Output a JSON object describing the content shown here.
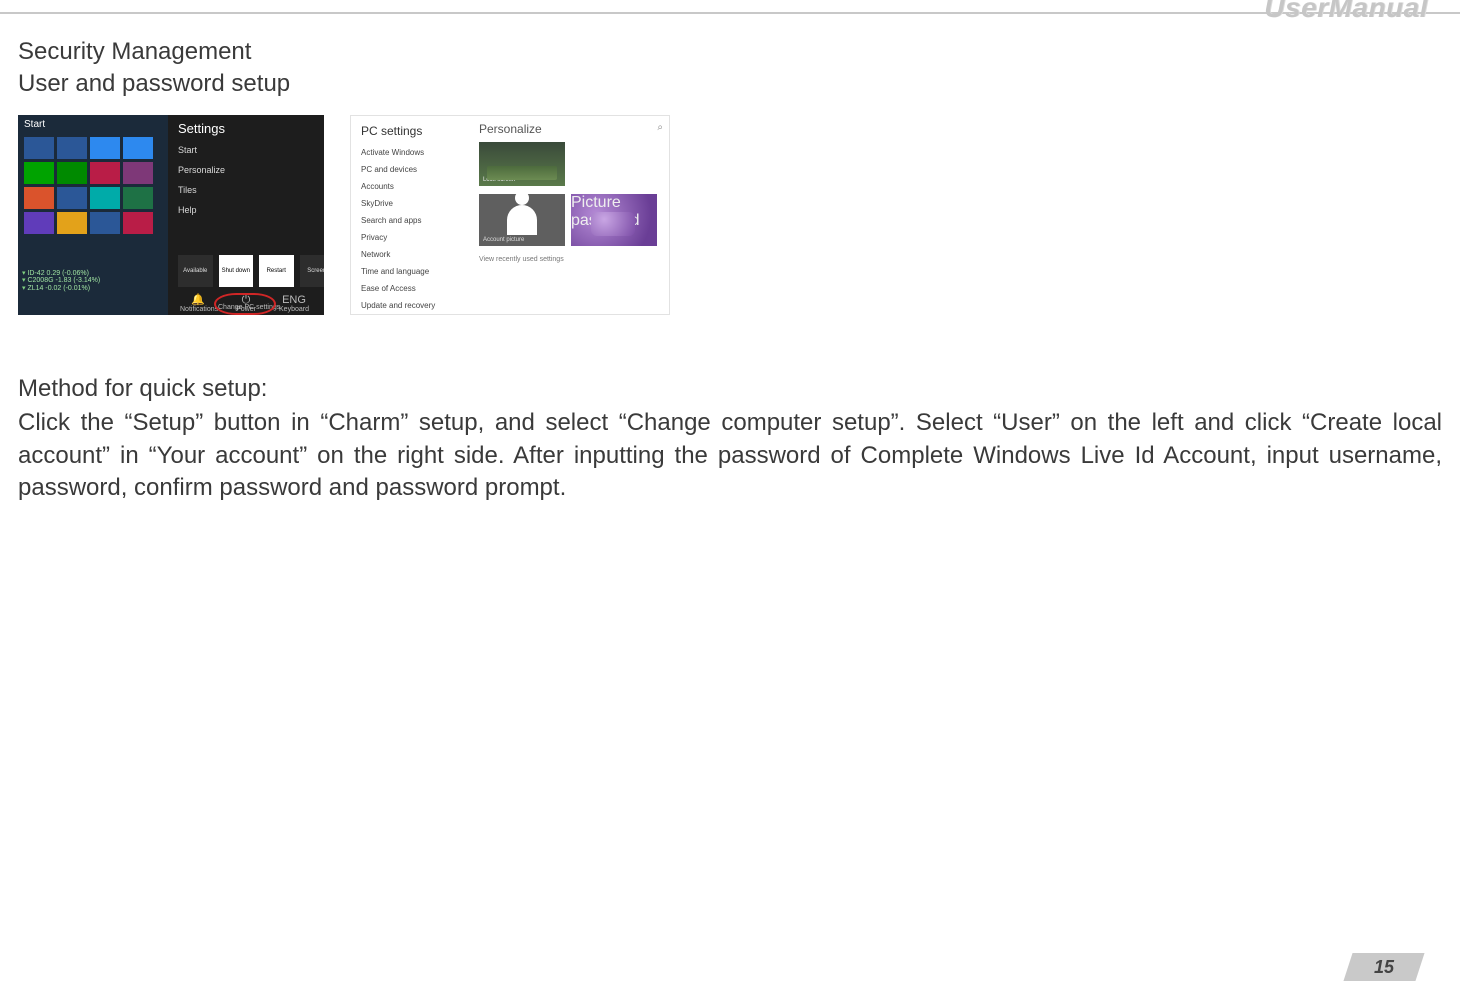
{
  "header": {
    "brand": "UserManual"
  },
  "headings": {
    "title": "Security Management",
    "subtitle": "User and password setup"
  },
  "screenshot1": {
    "start_label": "Start",
    "charm_title": "Settings",
    "charm_items": [
      "Start",
      "Personalize",
      "Tiles",
      "Help"
    ],
    "power_buttons": [
      "Available",
      "Shut down",
      "Restart",
      "Screen"
    ],
    "bottom_icons": [
      {
        "glyph": "🔔",
        "label": "Notifications"
      },
      {
        "glyph": "⏻",
        "label": "Power"
      },
      {
        "glyph": "ENG",
        "label": "Keyboard"
      }
    ],
    "change_pc_label": "Change PC settings",
    "wifi_rows": [
      "ID-42  0.29 (-0.06%)",
      "C2008G -1.83 (-3.14%)",
      "ZL14  -0.02 (-0.01%)"
    ],
    "tile_colors": [
      "#2b5797",
      "#2b5797",
      "#2d89ef",
      "#2d89ef",
      "#00a300",
      "#008a00",
      "#b91d47",
      "#7e3878",
      "#da532c",
      "#2b5797",
      "#00aba9",
      "#1e7145",
      "#603cba",
      "#e3a21a",
      "#2b5797",
      "#b91d47"
    ]
  },
  "screenshot2": {
    "nav_title": "PC settings",
    "nav_items": [
      "Activate Windows",
      "PC and devices",
      "Accounts",
      "SkyDrive",
      "Search and apps",
      "Privacy",
      "Network",
      "Time and language",
      "Ease of Access",
      "Update and recovery"
    ],
    "pane_title": "Personalize",
    "lock_caption": "Lock screen",
    "account_caption": "Account picture",
    "purple_caption": "Picture password",
    "recent_label": "View recently used settings"
  },
  "body": {
    "method_heading": "Method for quick setup:",
    "paragraph": "Click the “Setup” button in “Charm” setup, and select “Change computer setup”. Select “User” on the left and click “Create local account” in “Your account” on the right side. After inputting the password of Complete Windows Live Id Account, input username, password, confirm password and password prompt."
  },
  "footer": {
    "page_number": "15"
  }
}
